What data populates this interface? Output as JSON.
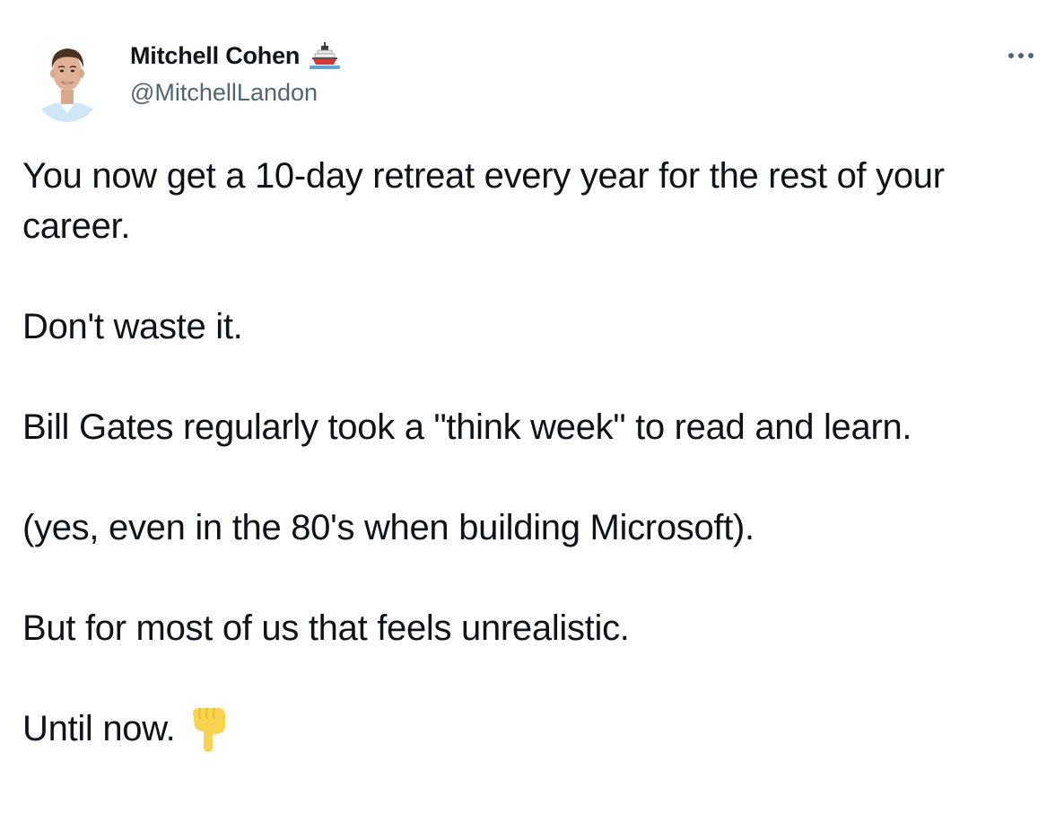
{
  "author": {
    "name": "Mitchell Cohen",
    "name_emoji": "ship-icon",
    "handle": "@MitchellLandon",
    "avatar": "avatar-photo"
  },
  "menu": {
    "more_icon": "more-horizontal-icon"
  },
  "tweet": {
    "paragraphs": [
      "You now get a 10-day retreat every year for the rest of your career.",
      "Don't waste it.",
      "Bill Gates regularly took a \"think week\" to read and learn.",
      "(yes, even in the 80's when building Microsoft).",
      "But for most of us that feels unrealistic.",
      "Until now."
    ],
    "trailing_emoji": "backhand-index-pointing-down-icon"
  },
  "colors": {
    "text_primary": "#0f1419",
    "text_secondary": "#536471",
    "emoji_yellow": "#f7d44c"
  }
}
